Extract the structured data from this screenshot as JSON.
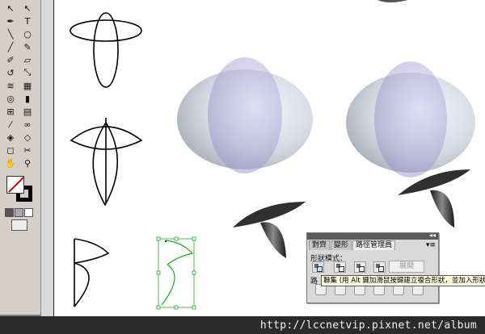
{
  "toolbar": {
    "tools": [
      {
        "icon": "direct-selection-icon",
        "glyph": "↖"
      },
      {
        "icon": "group-selection-icon",
        "glyph": "↖"
      },
      {
        "icon": "pen-icon",
        "glyph": "✒"
      },
      {
        "icon": "type-icon",
        "glyph": "T"
      },
      {
        "icon": "line-icon",
        "glyph": "╲"
      },
      {
        "icon": "ellipse-icon",
        "glyph": "○"
      },
      {
        "icon": "paintbrush-icon",
        "glyph": "╱"
      },
      {
        "icon": "pencil-icon",
        "glyph": "✎"
      },
      {
        "icon": "blob-brush-icon",
        "glyph": "✐"
      },
      {
        "icon": "eraser-icon",
        "glyph": "▱"
      },
      {
        "icon": "rotate-icon",
        "glyph": "↺"
      },
      {
        "icon": "scale-icon",
        "glyph": "⤡"
      },
      {
        "icon": "warp-icon",
        "glyph": "≋"
      },
      {
        "icon": "free-transform-icon",
        "glyph": "▦"
      },
      {
        "icon": "symbol-sprayer-icon",
        "glyph": "◎"
      },
      {
        "icon": "column-graph-icon",
        "glyph": "▮"
      },
      {
        "icon": "mesh-icon",
        "glyph": "⊞"
      },
      {
        "icon": "gradient-icon",
        "glyph": "▤"
      },
      {
        "icon": "eyedropper-icon",
        "glyph": "⁄"
      },
      {
        "icon": "blend-icon",
        "glyph": "∞"
      },
      {
        "icon": "live-paint-bucket-icon",
        "glyph": "◈"
      },
      {
        "icon": "live-paint-selection-icon",
        "glyph": "◇"
      },
      {
        "icon": "slice-icon",
        "glyph": "◻"
      },
      {
        "icon": "scissors-icon",
        "glyph": "✂"
      },
      {
        "icon": "hand-icon",
        "glyph": "✋"
      },
      {
        "icon": "zoom-icon",
        "glyph": "⚲"
      }
    ],
    "fill_stroke": {
      "fill": "#ffffff",
      "stroke": "#000000"
    }
  },
  "panel": {
    "tabs": [
      "對齊",
      "變形",
      "路徑管理員"
    ],
    "active_tab": 2,
    "shape_modes_label": "形狀模式：",
    "expand_label": "展開",
    "pathfinders_label": "路",
    "collapse_glyph": "◂◂",
    "close_glyph": "✕",
    "menu_glyph": "▾≡"
  },
  "tooltip": {
    "text": "聯集 (用 Alt 鍵加滑鼠按鍵建立複合形狀，並加入形狀區域)"
  },
  "footer": {
    "watermark": "http://lccnetvip.pixnet.net/album"
  },
  "colors": {
    "artboard": "#ffffff",
    "selection": "#22aa22",
    "sphere_gray": "#c7ccd6",
    "sphere_purple": "#a9a2d4",
    "stem_dark": "#2a2a2a"
  }
}
